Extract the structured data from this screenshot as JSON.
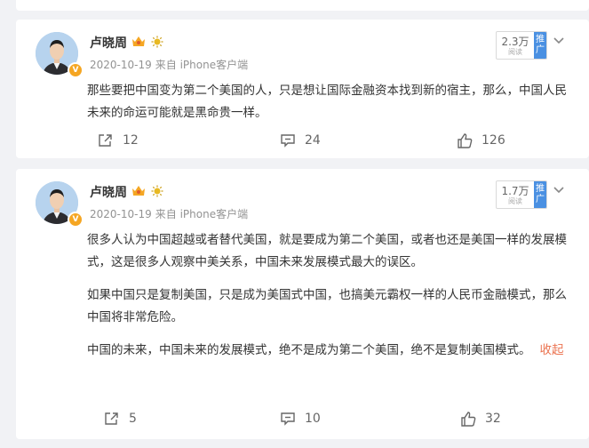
{
  "posts": [
    {
      "author": "卢晓周",
      "verified_badge": "V",
      "date": "2020-10-19",
      "source": "来自 iPhone客户端",
      "views": "2.3万",
      "views_label": "阅读",
      "promote_label": "推广",
      "paragraphs": [
        "那些要把中国变为第二个美国的人，只是想让国际金融资本找到新的宿主，那么，中国人民未来的命运可能就是黑命贵一样。"
      ],
      "shares": "12",
      "comments": "24",
      "likes": "126"
    },
    {
      "author": "卢晓周",
      "verified_badge": "V",
      "date": "2020-10-19",
      "source": "来自 iPhone客户端",
      "views": "1.7万",
      "views_label": "阅读",
      "promote_label": "推广",
      "paragraphs": [
        "很多人认为中国超越或者替代美国，就是要成为第二个美国，或者也还是美国一样的发展模式，这是很多人观察中美关系，中国未来发展模式最大的误区。",
        "如果中国只是复制美国，只是成为美国式中国，也搞美元霸权一样的人民币金融模式，那么中国将非常危险。",
        "中国的未来，中国未来的发展模式，绝不是成为第二个美国，绝不是复制美国模式。"
      ],
      "collapse_label": "收起",
      "shares": "5",
      "comments": "10",
      "likes": "32"
    }
  ],
  "colors": {
    "accent_link": "#eb7350",
    "promo_blue": "#4a90e2",
    "crown": "#f5a623"
  },
  "icons": [
    "crown-icon",
    "sun-icon",
    "chevron-down-icon",
    "share-icon",
    "comment-icon",
    "like-icon",
    "verified-badge-icon"
  ]
}
